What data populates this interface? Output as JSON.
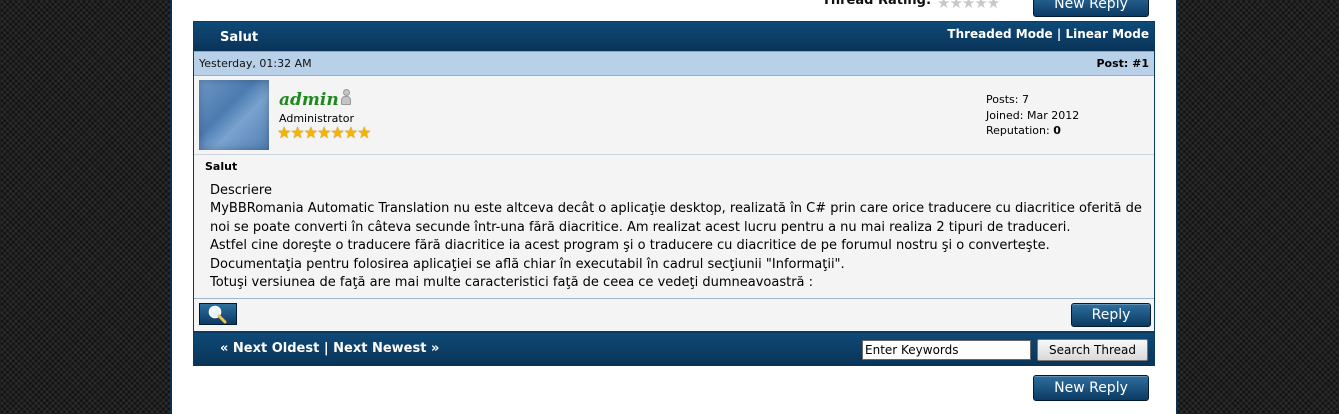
{
  "top": {
    "rating_label": "Thread Rating:",
    "rating_stars": "★★★★★",
    "new_reply_label": "New Reply"
  },
  "thread": {
    "title": "Salut",
    "threaded_mode": "Threaded Mode",
    "separator": " | ",
    "linear_mode": "Linear Mode"
  },
  "post": {
    "date": "Yesterday, 01:32 AM",
    "number": "Post: #1",
    "author": {
      "username": "admin",
      "usertitle": "Administrator",
      "stars": "★★★★★★★",
      "status_icon": "offline-user-icon",
      "posts_label": "Posts: ",
      "posts": "7",
      "joined_label": "Joined: ",
      "joined": "Mar 2012",
      "reputation_label": "Reputation: ",
      "reputation": "0"
    },
    "subject": "Salut",
    "message": [
      "Descriere",
      "MyBBRomania Automatic Translation nu este altceva decât o aplicaţie desktop, realizată în C# prin care orice traducere cu diacritice oferită de noi se poate converti în câteva secunde într-una fără diacritice. Am realizat acest lucru pentru a nu mai realiza 2 tipuri de traduceri.",
      "Astfel cine doreşte o traducere fără diacritice ia acest program şi o traducere cu diacritice de pe forumul nostru şi o converteşte.",
      "Documentaţia pentru folosirea aplicaţiei se află chiar în executabil în cadrul secţiunii \"Informaţii\".",
      "Totuşi versiunea de faţă are mai multe caracteristici faţă de ceea ce vedeţi dumneavoastră :"
    ],
    "find_icon": "magnifier-icon",
    "reply_label": "Reply"
  },
  "navigation": {
    "next_oldest": "« Next Oldest",
    "separator": " | ",
    "next_newest": "Next Newest »",
    "search_placeholder": "Enter Keywords",
    "search_value": "Enter Keywords",
    "search_button": "Search Thread"
  },
  "bottom": {
    "new_reply_label": "New Reply"
  },
  "colors": {
    "header_blue": "#0b3a62",
    "date_bar": "#b9d1e8",
    "username_green": "#1e8a1e",
    "star_gold": "#f5b400"
  }
}
